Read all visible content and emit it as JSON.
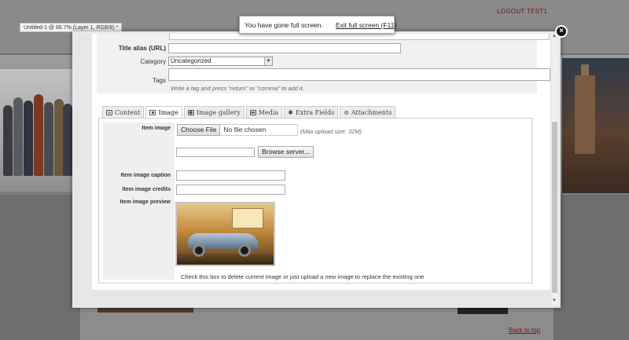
{
  "background": {
    "logout_label": "LOGOUT TEST1",
    "document_title": "Untitled-1 @ 66.7% (Layer 1, RGB/8) *",
    "back_to_top": "Back to top"
  },
  "fullscreen_notice": {
    "message": "You have gone full screen.",
    "exit_label": "Exit full screen (F11)"
  },
  "modal": {
    "close_symbol": "×",
    "form": {
      "title_alias_label": "Title alias (URL)",
      "title_alias_value": "",
      "category_label": "Category",
      "category_value": "Uncategorized",
      "tags_label": "Tags",
      "tags_hint": "Write a tag and press \"return\" or \"comma\" to add it."
    },
    "tabs": [
      {
        "label": "Content",
        "icon": "document-icon"
      },
      {
        "label": "Image",
        "icon": "image-icon"
      },
      {
        "label": "Image gallery",
        "icon": "camera-icon"
      },
      {
        "label": "Media",
        "icon": "film-icon"
      },
      {
        "label": "Extra Fields",
        "icon": "puzzle-icon"
      },
      {
        "label": "Attachments",
        "icon": "paperclip-icon"
      }
    ],
    "active_tab": "Image",
    "image_panel": {
      "item_image_label": "Item image",
      "choose_file_label": "Choose File",
      "no_file_label": "No file chosen",
      "max_upload": "(Max upload size: 32M)",
      "browse_server_label": "Browse server...",
      "caption_label": "Item image caption",
      "credits_label": "Item image credits",
      "preview_label": "Item image preview",
      "delete_note": "Check this box to delete current image or just upload a new image to replace the existing one"
    }
  }
}
